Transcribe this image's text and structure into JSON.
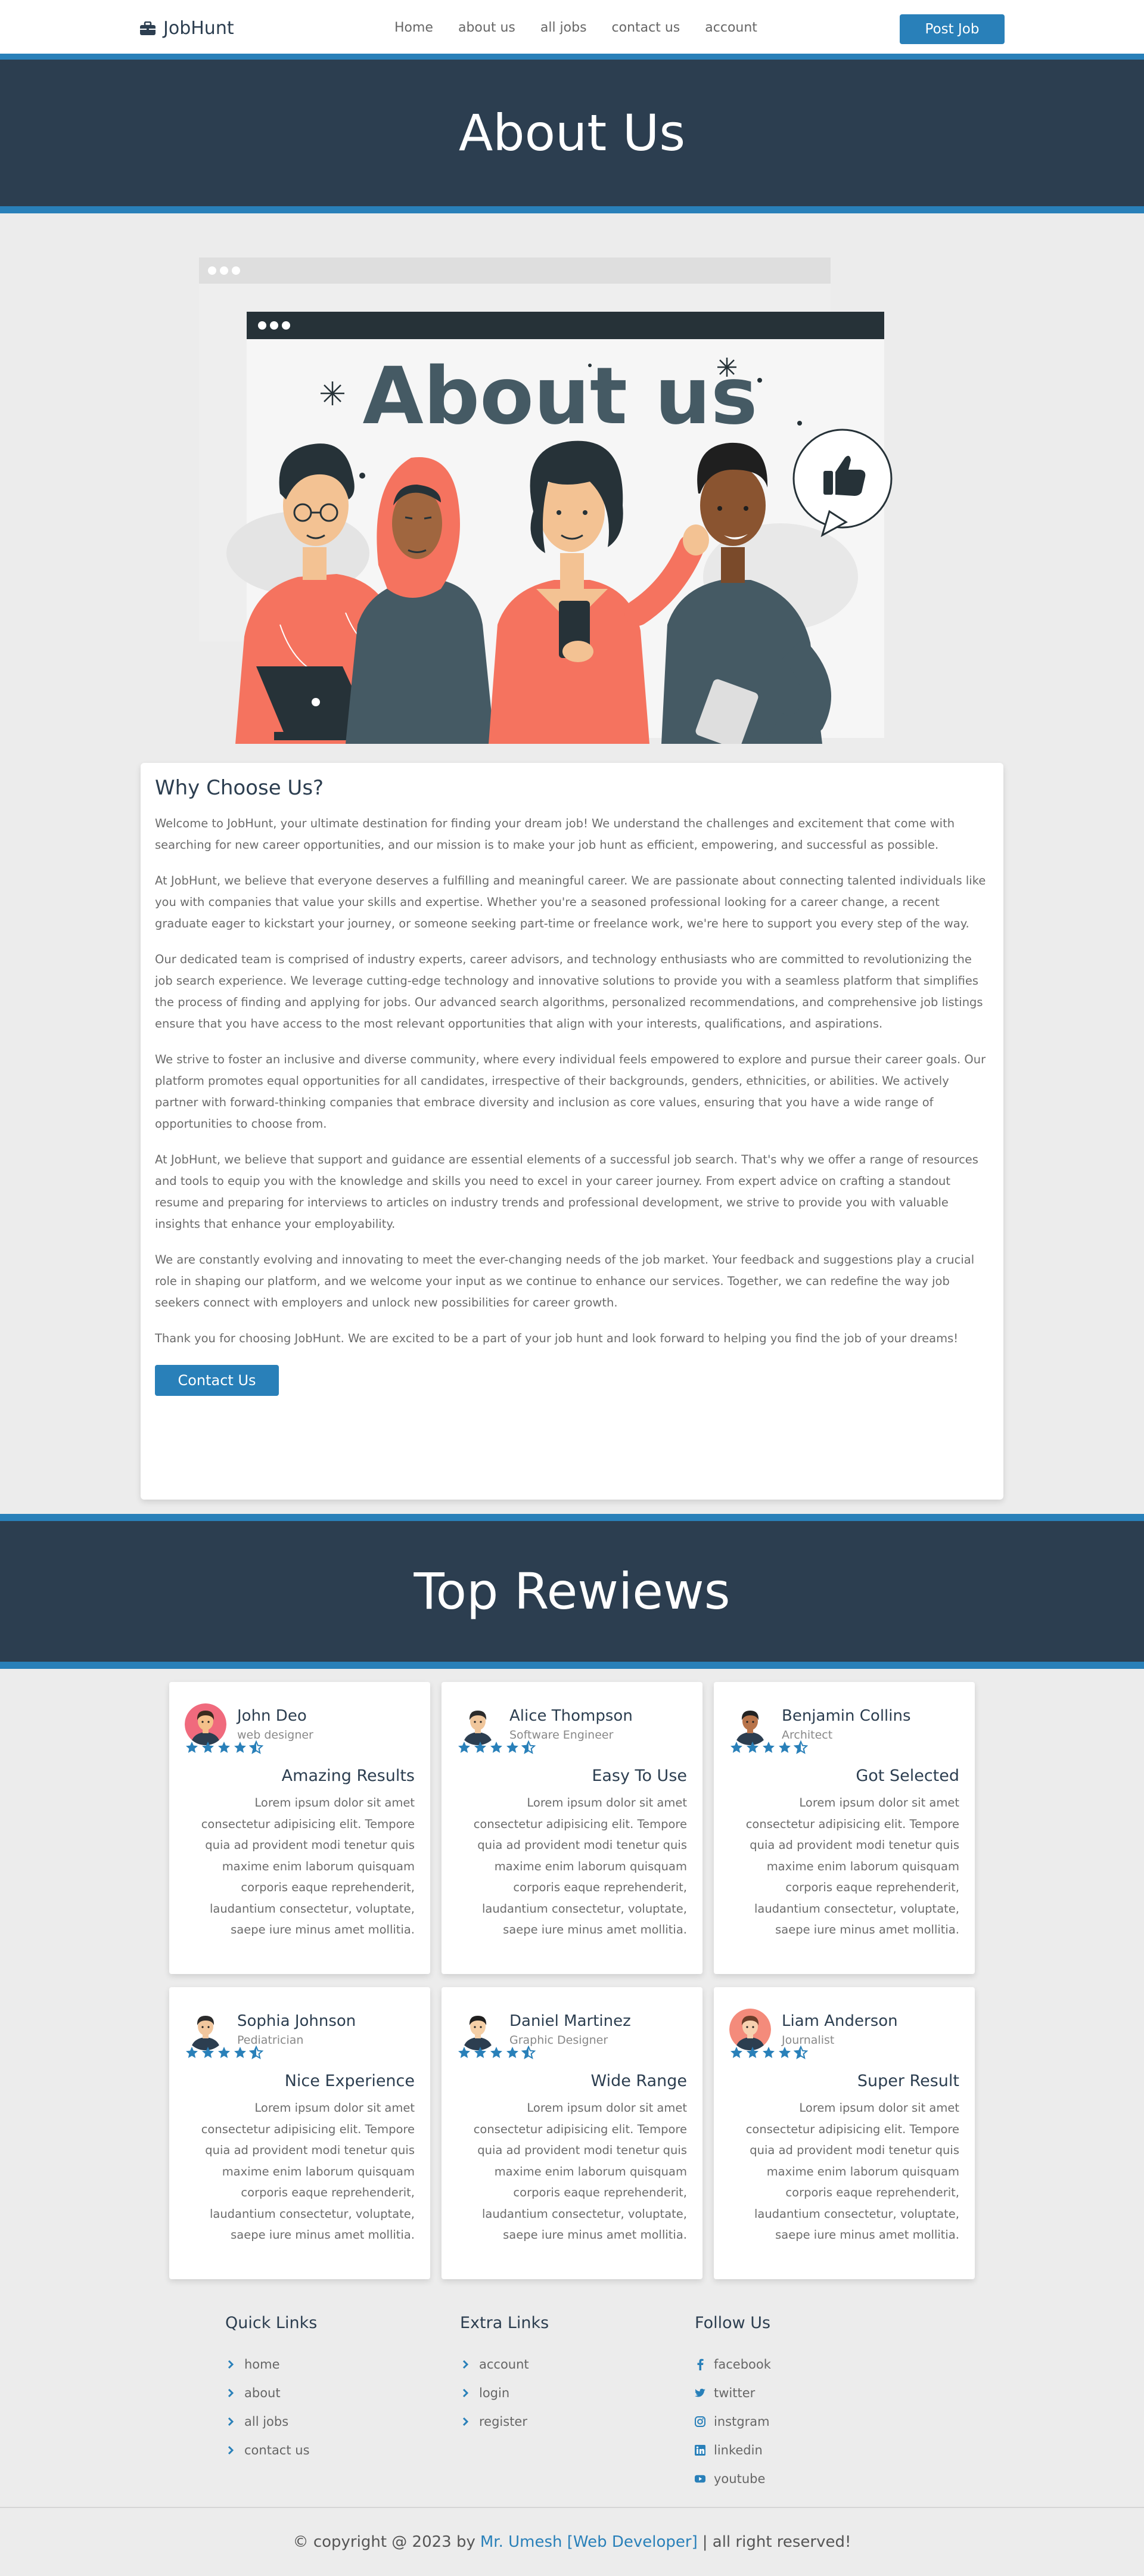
{
  "nav": {
    "brand": "JobHunt",
    "links": [
      "Home",
      "about us",
      "all jobs",
      "contact us",
      "account"
    ],
    "post_button": "Post Job"
  },
  "about": {
    "heading": "About Us",
    "illustration_text": "About us"
  },
  "why": {
    "title": "Why Choose Us?",
    "paragraphs": [
      "Welcome to JobHunt, your ultimate destination for finding your dream job! We understand the challenges and excitement that come with searching for new career opportunities, and our mission is to make your job hunt as efficient, empowering, and successful as possible.",
      "At JobHunt, we believe that everyone deserves a fulfilling and meaningful career. We are passionate about connecting talented individuals like you with companies that value your skills and expertise. Whether you're a seasoned professional looking for a career change, a recent graduate eager to kickstart your journey, or someone seeking part-time or freelance work, we're here to support you every step of the way.",
      "Our dedicated team is comprised of industry experts, career advisors, and technology enthusiasts who are committed to revolutionizing the job search experience. We leverage cutting-edge technology and innovative solutions to provide you with a seamless platform that simplifies the process of finding and applying for jobs. Our advanced search algorithms, personalized recommendations, and comprehensive job listings ensure that you have access to the most relevant opportunities that align with your interests, qualifications, and aspirations.",
      "We strive to foster an inclusive and diverse community, where every individual feels empowered to explore and pursue their career goals. Our platform promotes equal opportunities for all candidates, irrespective of their backgrounds, genders, ethnicities, or abilities. We actively partner with forward-thinking companies that embrace diversity and inclusion as core values, ensuring that you have a wide range of opportunities to choose from.",
      "At JobHunt, we believe that support and guidance are essential elements of a successful job search. That's why we offer a range of resources and tools to equip you with the knowledge and skills you need to excel in your career journey. From expert advice on crafting a standout resume and preparing for interviews to articles on industry trends and professional development, we strive to provide you with valuable insights that enhance your employability.",
      "We are constantly evolving and innovating to meet the ever-changing needs of the job market. Your feedback and suggestions play a crucial role in shaping our platform, and we welcome your input as we continue to enhance our services. Together, we can redefine the way job seekers connect with employers and unlock new possibilities for career growth.",
      "Thank you for choosing JobHunt. We are excited to be a part of your job hunt and look forward to helping you find the job of your dreams!"
    ],
    "button": "Contact Us"
  },
  "reviews": {
    "heading": "Top Rewiews",
    "lorem": "Lorem ipsum dolor sit amet consectetur adipisicing elit. Tempore quia ad provident modi tenetur quis maxime enim laborum quisquam corporis eaque reprehenderit, laudantium consectetur, voluptate, saepe iure minus amet mollitia.",
    "items": [
      {
        "name": "John Deo",
        "role": "web designer",
        "title": "Amazing Results",
        "rating": 4.5,
        "avatar_bg": "#f06a7d",
        "skin": "#f5c08a",
        "hair": "#3b2a1e"
      },
      {
        "name": "Alice Thompson",
        "role": "Software Engineer",
        "title": "Easy To Use",
        "rating": 4.5,
        "avatar_bg": "#ffffff",
        "skin": "#f0c69b",
        "hair": "#2b2b2b"
      },
      {
        "name": "Benjamin Collins",
        "role": "Architect",
        "title": "Got Selected",
        "rating": 4.5,
        "avatar_bg": "#ffffff",
        "skin": "#b8744a",
        "hair": "#222222"
      },
      {
        "name": "Sophia Johnson",
        "role": "Pediatrician",
        "title": "Nice Experience",
        "rating": 4.5,
        "avatar_bg": "#ffffff",
        "skin": "#f2c79e",
        "hair": "#2b2b2b"
      },
      {
        "name": "Daniel Martinez",
        "role": "Graphic Designer",
        "title": "Wide Range",
        "rating": 4.5,
        "avatar_bg": "#ffffff",
        "skin": "#f5cfa6",
        "hair": "#1f1f1f"
      },
      {
        "name": "Liam Anderson",
        "role": "Journalist",
        "title": "Super Result",
        "rating": 4.5,
        "avatar_bg": "#f48b7b",
        "skin": "#f7d1b0",
        "hair": "#6a3d2a"
      }
    ]
  },
  "footer": {
    "quick": {
      "title": "Quick Links",
      "items": [
        "home",
        "about",
        "all jobs",
        "contact us"
      ]
    },
    "extra": {
      "title": "Extra Links",
      "items": [
        "account",
        "login",
        "register"
      ]
    },
    "follow": {
      "title": "Follow Us",
      "items": [
        "facebook",
        "twitter",
        "instgram",
        "linkedin",
        "youtube"
      ]
    },
    "copyright_prefix": "© copyright @ 2023 by",
    "credit": "Mr. Umesh [Web Developer]",
    "copyright_suffix": "| all right reserved!"
  },
  "colors": {
    "primary": "#2980b9",
    "dark": "#2c3e50",
    "salmon": "#f5735f",
    "slate": "#455a64",
    "page_bg": "#ececec"
  }
}
